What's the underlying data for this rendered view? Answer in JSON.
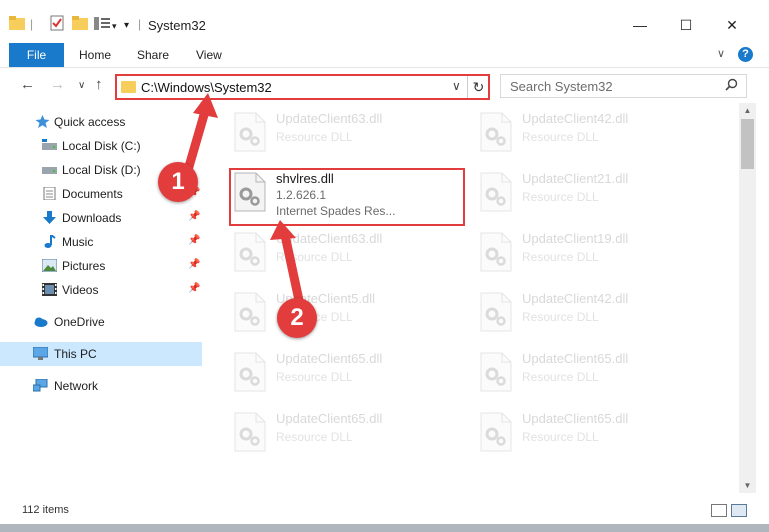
{
  "window": {
    "title": "System32",
    "minimize": "—",
    "maximize": "☐",
    "close": "✕"
  },
  "ribbon": {
    "tabs": [
      "File",
      "Home",
      "Share",
      "View"
    ],
    "help": "?",
    "collapse": "∨"
  },
  "address": {
    "path": "C:\\Windows\\System32",
    "dropdown": "∨",
    "refresh": "↻"
  },
  "search": {
    "placeholder": "Search System32"
  },
  "nav": {
    "back": "←",
    "forward": "→",
    "recent": "∨",
    "up": "↑"
  },
  "sidebar": {
    "items": [
      {
        "label": "Quick access",
        "icon": "star-icon",
        "pinned": false
      },
      {
        "label": "Local Disk (C:)",
        "icon": "drive-icon",
        "pinned": false
      },
      {
        "label": "Local Disk (D:)",
        "icon": "drive-icon",
        "pinned": false
      },
      {
        "label": "Documents",
        "icon": "documents-icon",
        "pinned": true
      },
      {
        "label": "Downloads",
        "icon": "download-icon",
        "pinned": true
      },
      {
        "label": "Music",
        "icon": "music-icon",
        "pinned": true
      },
      {
        "label": "Pictures",
        "icon": "pictures-icon",
        "pinned": true
      },
      {
        "label": "Videos",
        "icon": "videos-icon",
        "pinned": true
      },
      {
        "label": "OneDrive",
        "icon": "cloud-icon",
        "pinned": false
      },
      {
        "label": "This PC",
        "icon": "computer-icon",
        "pinned": false
      },
      {
        "label": "Network",
        "icon": "network-icon",
        "pinned": false
      }
    ]
  },
  "files": {
    "left": [
      {
        "name": "UpdateClient63.dll",
        "desc": "Resource DLL"
      },
      {
        "name": "shvlres.dll",
        "version": "1.2.626.1",
        "desc": "Internet Spades Res...",
        "highlighted": true
      },
      {
        "name": "UpdateClient63.dll",
        "desc": "Resource DLL"
      },
      {
        "name": "UpdateClient5.dll",
        "desc": "Resource DLL"
      },
      {
        "name": "UpdateClient65.dll",
        "desc": "Resource DLL"
      },
      {
        "name": "UpdateClient65.dll",
        "desc": "Resource DLL"
      }
    ],
    "right": [
      {
        "name": "UpdateClient42.dll",
        "desc": "Resource DLL"
      },
      {
        "name": "UpdateClient21.dll",
        "desc": "Resource DLL"
      },
      {
        "name": "UpdateClient19.dll",
        "desc": "Resource DLL"
      },
      {
        "name": "UpdateClient42.dll",
        "desc": "Resource DLL"
      },
      {
        "name": "UpdateClient65.dll",
        "desc": "Resource DLL"
      },
      {
        "name": "UpdateClient65.dll",
        "desc": "Resource DLL"
      }
    ]
  },
  "status": {
    "count": "112 items"
  },
  "callouts": [
    "1",
    "2"
  ],
  "colors": {
    "accent": "#1979ca",
    "highlight": "#e23c3c",
    "selected": "#cce8ff"
  }
}
